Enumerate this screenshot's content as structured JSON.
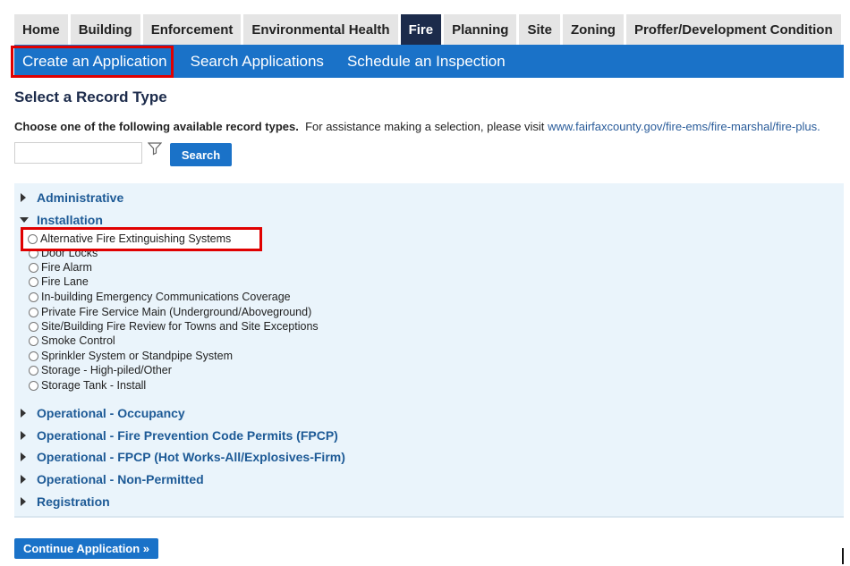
{
  "top_tabs": [
    {
      "label": "Home"
    },
    {
      "label": "Building"
    },
    {
      "label": "Enforcement"
    },
    {
      "label": "Environmental Health"
    },
    {
      "label": "Fire",
      "active": true
    },
    {
      "label": "Planning"
    },
    {
      "label": "Site"
    },
    {
      "label": "Zoning"
    },
    {
      "label": "Proffer/Development Condition"
    }
  ],
  "subnav": [
    {
      "label": "Create an Application"
    },
    {
      "label": "Search Applications"
    },
    {
      "label": "Schedule an Inspection"
    }
  ],
  "page_title": "Select a Record Type",
  "instructions": {
    "bold": "Choose one of the following available record types.",
    "text": "For assistance making a selection, please visit",
    "link": "www.fairfaxcounty.gov/fire-ems/fire-marshal/fire-plus."
  },
  "search": {
    "value": "",
    "button_label": "Search"
  },
  "categories": {
    "administrative": "Administrative",
    "installation": "Installation",
    "operational_occupancy": "Operational - Occupancy",
    "operational_fpcp": "Operational - Fire Prevention Code Permits (FPCP)",
    "operational_hot_works": "Operational - FPCP (Hot Works-All/Explosives-Firm)",
    "operational_non_permitted": "Operational - Non-Permitted",
    "registration": "Registration"
  },
  "installation_options": [
    "Alternative Fire Extinguishing Systems",
    "Door Locks",
    "Fire Alarm",
    "Fire Lane",
    "In-building Emergency Communications Coverage",
    "Private Fire Service Main (Underground/Aboveground)",
    "Site/Building Fire Review for Towns and Site Exceptions",
    "Smoke Control",
    "Sprinkler System or Standpipe System",
    "Storage - High-piled/Other",
    "Storage Tank - Install"
  ],
  "continue_label": "Continue Application »",
  "colors": {
    "accent": "#1a72c8",
    "active_tab": "#1c2b4b",
    "highlight": "#e00000",
    "panel": "#eaf4fb",
    "link": "#1d5a96"
  }
}
